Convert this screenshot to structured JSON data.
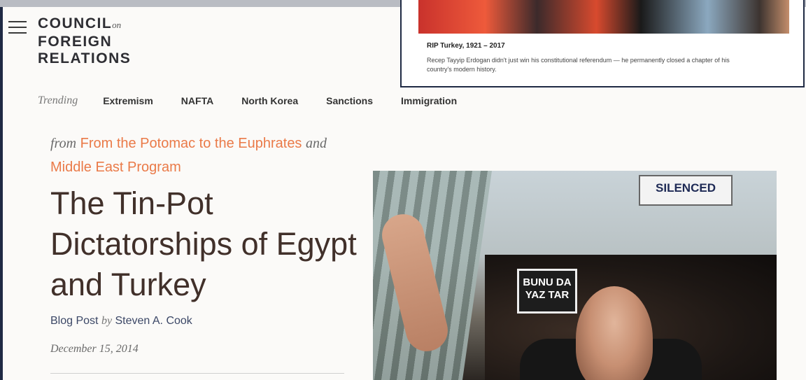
{
  "site": {
    "logo_line1": "COUNCIL",
    "logo_on": "on",
    "logo_line2": "FOREIGN",
    "logo_line3": "RELATIONS"
  },
  "trending": {
    "label": "Trending",
    "links": [
      "Extremism",
      "NAFTA",
      "North Korea",
      "Sanctions",
      "Immigration"
    ]
  },
  "article": {
    "from_word": "from",
    "blog_name": "From the Potomac to the Euphrates",
    "and_word": "and",
    "program": "Middle East Program",
    "title": "The Tin-Pot Dictatorships of Egypt and Turkey",
    "type": "Blog Post",
    "by_word": "by",
    "author": "Steven A. Cook",
    "date": "December 15, 2014"
  },
  "photo": {
    "sign_left": "BUNU DA YAZ TAR",
    "sign_right": "SILENCED"
  },
  "overlay_card": {
    "title": "RIP Turkey, 1921 – 2017",
    "description": "Recep Tayyip Erdogan didn't just win his constitutional referendum — he permanently closed a chapter of his country's modern history."
  }
}
